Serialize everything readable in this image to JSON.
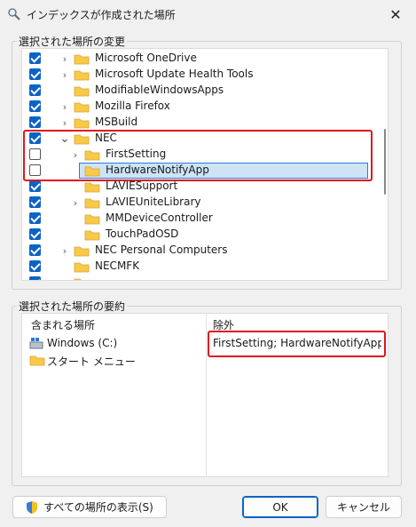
{
  "window": {
    "title": "インデックスが作成された場所",
    "close_glyph": "✕"
  },
  "selected_group": {
    "label": "選択された場所の変更"
  },
  "tree": [
    {
      "label": "Microsoft OneDrive",
      "checked": true,
      "expander": true,
      "indent": 0
    },
    {
      "label": "Microsoft Update Health Tools",
      "checked": true,
      "expander": true,
      "indent": 0
    },
    {
      "label": "ModifiableWindowsApps",
      "checked": true,
      "expander": false,
      "indent": 0
    },
    {
      "label": "Mozilla Firefox",
      "checked": true,
      "expander": true,
      "indent": 0
    },
    {
      "label": "MSBuild",
      "checked": true,
      "expander": true,
      "indent": 0
    },
    {
      "label": "NEC",
      "checked": true,
      "expander": true,
      "expanded": true,
      "indent": 0
    },
    {
      "label": "FirstSetting",
      "checked": false,
      "expander": true,
      "indent": 1
    },
    {
      "label": "HardwareNotifyApp",
      "checked": false,
      "expander": false,
      "indent": 1,
      "selected": true
    },
    {
      "label": "LAVIESupport",
      "checked": true,
      "expander": false,
      "indent": 1
    },
    {
      "label": "LAVIEUniteLibrary",
      "checked": true,
      "expander": true,
      "indent": 1
    },
    {
      "label": "MMDeviceController",
      "checked": true,
      "expander": false,
      "indent": 1
    },
    {
      "label": "TouchPadOSD",
      "checked": true,
      "expander": false,
      "indent": 1
    },
    {
      "label": "NEC Personal Computers",
      "checked": true,
      "expander": true,
      "indent": 0
    },
    {
      "label": "NECMFK",
      "checked": true,
      "expander": false,
      "indent": 0
    },
    {
      "label": "",
      "checked": true,
      "expander": true,
      "indent": 0
    }
  ],
  "summary_group": {
    "label": "選択された場所の要約"
  },
  "summary": {
    "included_header": "含まれる場所",
    "excluded_header": "除外",
    "included": [
      "Windows (C:)",
      "スタート メニュー"
    ],
    "excluded": "FirstSetting; HardwareNotifyApp; ..."
  },
  "buttons": {
    "show_all": "すべての場所の表示(S)",
    "ok": "OK",
    "cancel": "キャンセル"
  },
  "colors": {
    "accent": "#0a64c8",
    "highlight": "#e0141e",
    "folder": "#f8c94a"
  }
}
